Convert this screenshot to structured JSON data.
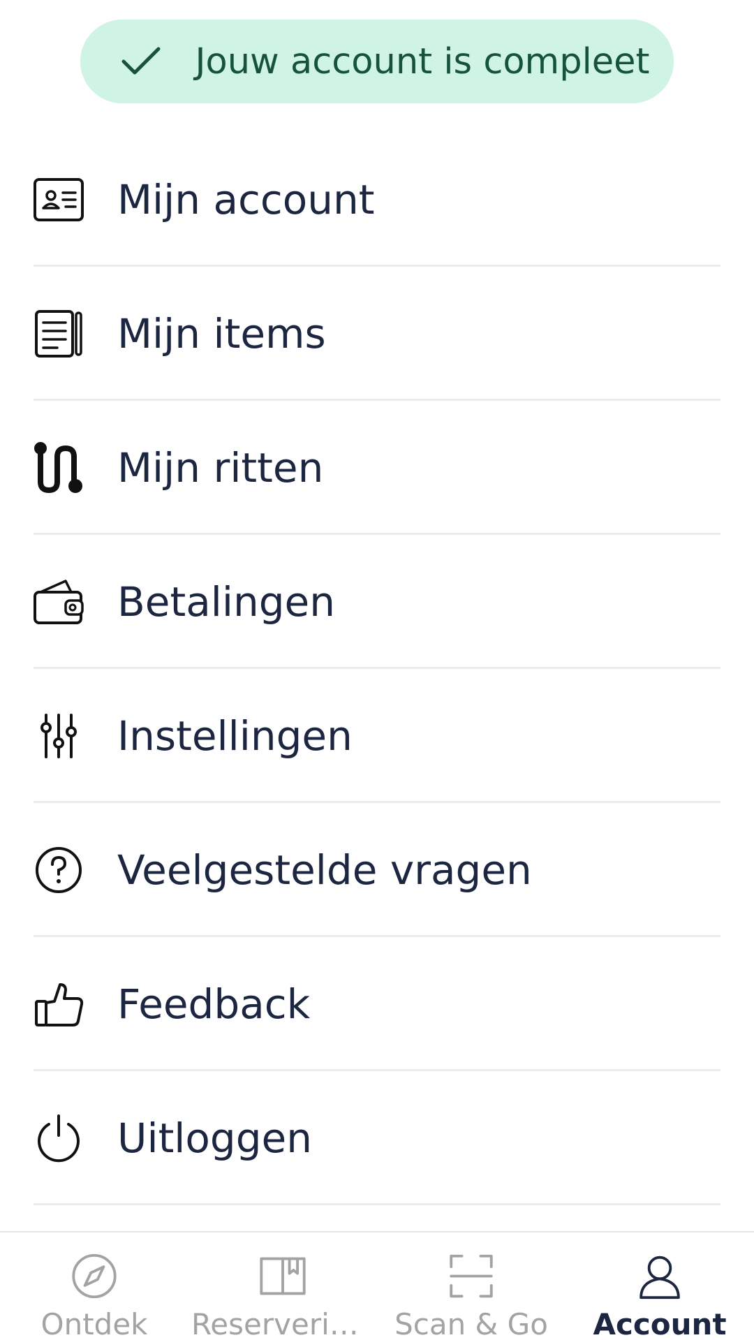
{
  "banner": {
    "icon": "check-icon",
    "text": "Jouw account is compleet",
    "background_color": "#cff4e3",
    "text_color": "#17533a"
  },
  "menu": {
    "items": [
      {
        "label": "Mijn account",
        "icon": "id-card-icon"
      },
      {
        "label": "Mijn items",
        "icon": "document-list-icon"
      },
      {
        "label": "Mijn ritten",
        "icon": "route-icon"
      },
      {
        "label": "Betalingen",
        "icon": "wallet-icon"
      },
      {
        "label": "Instellingen",
        "icon": "sliders-icon"
      },
      {
        "label": "Veelgestelde vragen",
        "icon": "question-circle-icon"
      },
      {
        "label": "Feedback",
        "icon": "thumbs-up-icon"
      },
      {
        "label": "Uitloggen",
        "icon": "power-icon"
      }
    ]
  },
  "tabbar": {
    "tabs": [
      {
        "label": "Ontdek",
        "icon": "compass-icon",
        "active": false
      },
      {
        "label": "Reserverin...",
        "icon": "book-icon",
        "active": false
      },
      {
        "label": "Scan & Go",
        "icon": "scan-icon",
        "active": false
      },
      {
        "label": "Account",
        "icon": "user-icon",
        "active": true
      }
    ]
  },
  "colors": {
    "text": "#1c2640",
    "inactive": "#a3a3a3",
    "divider": "#ebebeb"
  }
}
